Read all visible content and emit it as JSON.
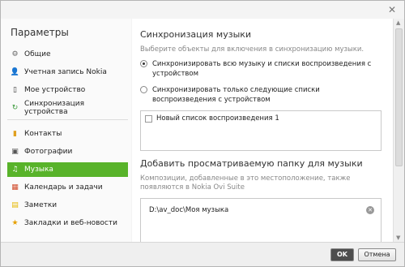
{
  "window": {
    "close_glyph": "✕"
  },
  "sidebar": {
    "title": "Параметры",
    "items": [
      {
        "label": "Общие",
        "icon": "gear-icon",
        "glyph": "⚙",
        "color": "#666666"
      },
      {
        "label": "Учетная запись Nokia",
        "icon": "user-icon",
        "glyph": "👤",
        "color": "#2f62b8"
      },
      {
        "label": "Мое устройство",
        "icon": "phone-icon",
        "glyph": "▯",
        "color": "#333333"
      },
      {
        "label": "Синхронизация устройства",
        "icon": "sync-icon",
        "glyph": "↻",
        "color": "#3a9a3a"
      },
      {
        "label": "Контакты",
        "icon": "contacts-icon",
        "glyph": "▮",
        "color": "#e0a020"
      },
      {
        "label": "Фотографии",
        "icon": "photos-icon",
        "glyph": "▣",
        "color": "#555555"
      },
      {
        "label": "Музыка",
        "icon": "music-icon",
        "glyph": "♫",
        "color": "#c2185b",
        "active": true
      },
      {
        "label": "Календарь и задачи",
        "icon": "calendar-icon",
        "glyph": "▦",
        "color": "#d14a2a"
      },
      {
        "label": "Заметки",
        "icon": "notes-icon",
        "glyph": "▤",
        "color": "#e6b800"
      },
      {
        "label": "Закладки и веб-новости",
        "icon": "bookmarks-icon",
        "glyph": "★",
        "color": "#e6a000"
      }
    ]
  },
  "main": {
    "sync_title": "Синхронизация музыки",
    "sync_hint": "Выберите объекты для включения в синхронизацию музыки.",
    "radio_all": "Синхронизировать всю музыку и списки воспроизведения с устройством",
    "radio_selected": "Синхронизировать только следующие списки воспроизведения с устройством",
    "playlist_item": "Новый список воспроизведения 1",
    "folder_title": "Добавить просматриваемую папку для музыки",
    "folder_hint": "Композиции, добавленные в это местоположение, также появляются в Nokia Ovi Suite",
    "folder_path": "D:\\av_doc\\Моя музыка"
  },
  "footer": {
    "ok_label": "OK",
    "cancel_label": "Отмена"
  }
}
